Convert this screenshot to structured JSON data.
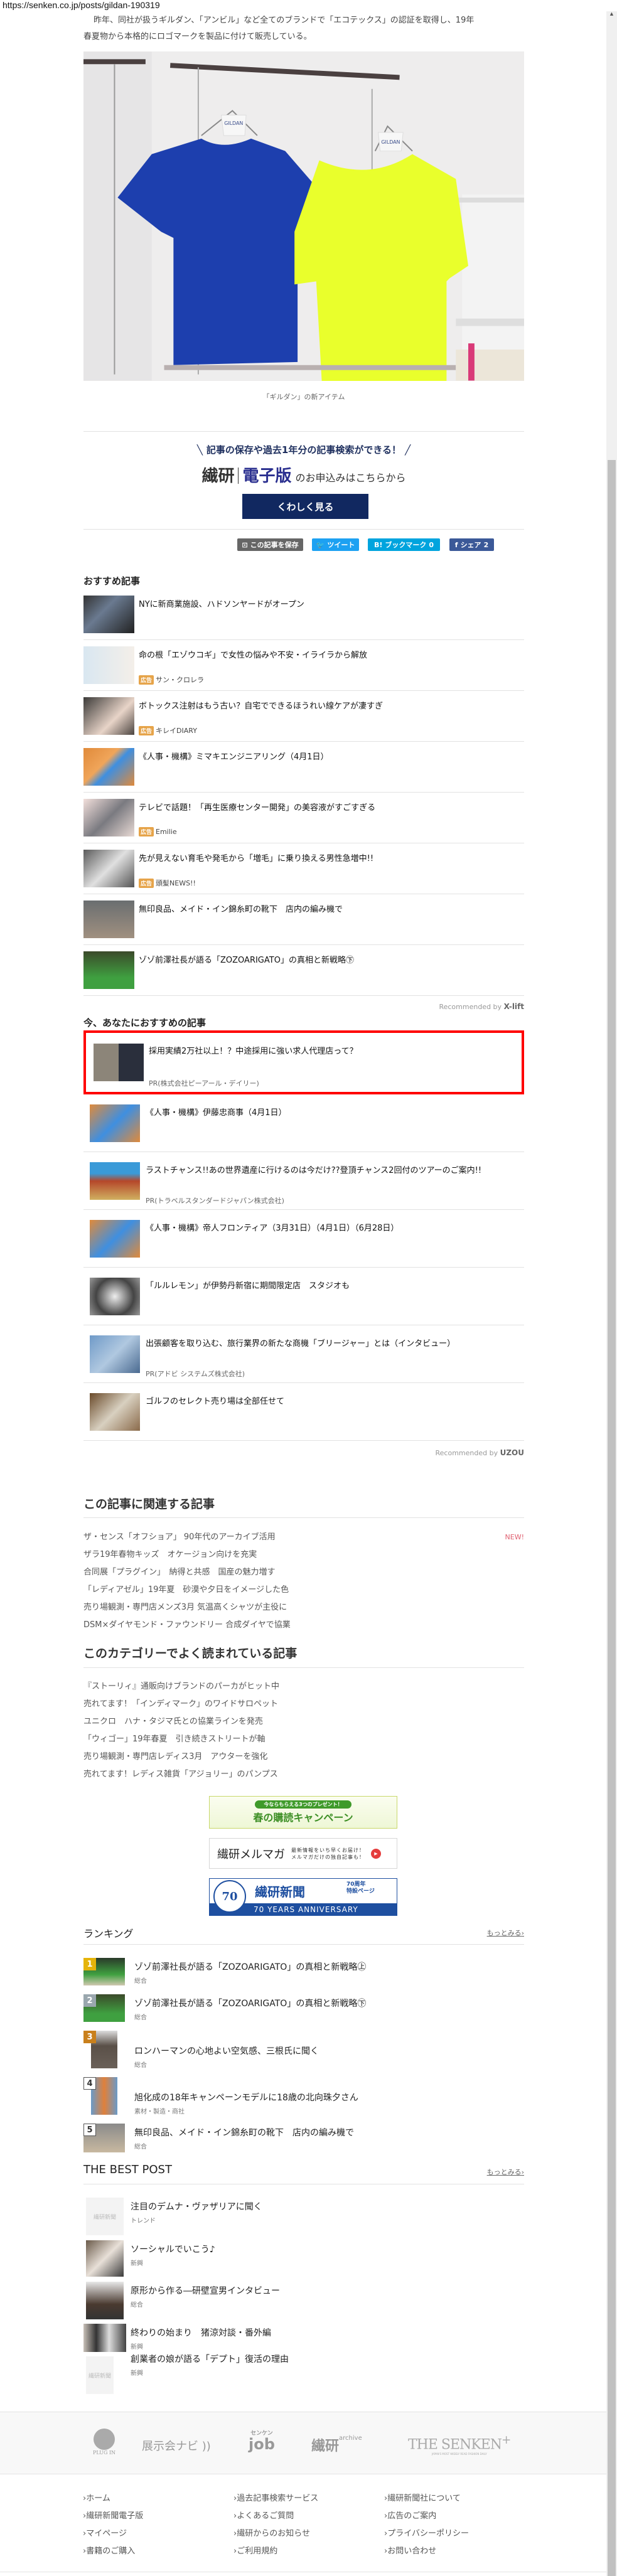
{
  "url": "https://senken.co.jp/posts/gildan-190319",
  "article": {
    "lines": [
      "昨年、同社が扱うギルダン、「アンビル」など全てのブランドで「エコテックス」の認証を取得し、19年",
      "春夏物から本格的にロゴマークを製品に付けて販売している。"
    ],
    "caption": "「ギルダン」の新アイテム",
    "photo_text": "GILDAN"
  },
  "promo": {
    "tagline": "記事の保存や過去1年分の記事検索ができる！",
    "logo_left": "繊研",
    "logo_right": "電子版",
    "suffix": "のお申込みはこちらから",
    "button": "くわしく見る"
  },
  "share": {
    "save": "この記事を保存",
    "tweet": "ツイート",
    "bookmark": "ブックマーク",
    "bookmark_count": "0",
    "facebook": "シェア",
    "facebook_count": "2",
    "colors": {
      "save": "#666666",
      "tweet": "#1da1f2",
      "bookmark": "#00a4de",
      "facebook": "#3b5998"
    }
  },
  "recommended": {
    "title": "おすすめ記事",
    "ad_label": "広告",
    "items": [
      {
        "title": "NYに新商業施設、ハドソンヤードがオープン",
        "source": ""
      },
      {
        "title": "命の根「エゾウコギ」で女性の悩みや不安・イライラから解放",
        "source": "サン・クロレラ"
      },
      {
        "title": "ボトックス注射はもう古い？自宅でできるほうれい線ケアが凄すぎ",
        "source": "キレイDIARY"
      },
      {
        "title": "《人事・機構》ミマキエンジニアリング（4月1日）",
        "source": ""
      },
      {
        "title": "テレビで話題！「再生医療センター開発」の美容液がすごすぎる",
        "source": "Emilie"
      },
      {
        "title": "先が見えない育毛や発毛から「増毛」に乗り換える男性急増中!!",
        "source": "頭髪NEWS!!"
      },
      {
        "title": "無印良品、メイド・イン錦糸町の靴下　店内の編み機で",
        "source": ""
      },
      {
        "title": "ゾゾ前澤社長が語る「ZOZOARIGATO」の真相と新戦略㊦",
        "source": ""
      }
    ],
    "recommended_by": "Recommended by",
    "provider": "X-lift"
  },
  "for_you": {
    "title": "今、あなたにおすすめの記事",
    "highlighted": {
      "title": "採用実績2万社以上！？中途採用に強い求人代理店って？",
      "pr": "PR(株式会社ピーアール・デイリー)"
    },
    "items": [
      {
        "title": "《人事・機構》伊藤忠商事（4月1日）",
        "pr": ""
      },
      {
        "title": "ラストチャンス!!あの世界遺産に行けるのは今だけ??登頂チャンス2回付のツアーのご案内!!",
        "pr": "PR(トラベルスタンダードジャパン株式会社)"
      },
      {
        "title": "《人事・機構》帝人フロンティア（3月31日）（4月1日）（6月28日）",
        "pr": ""
      },
      {
        "title": "「ルルレモン」が伊勢丹新宿に期間限定店　スタジオも",
        "pr": ""
      },
      {
        "title": "出張顧客を取り込む、旅行業界の新たな商機「ブリージャー」とは（インタビュー）",
        "pr": "PR(アドビ システムズ株式会社)"
      },
      {
        "title": "ゴルフのセレクト売り場は全部任せて",
        "pr": ""
      }
    ],
    "recommended_by": "Recommended by",
    "provider": "UZOU"
  },
  "related": {
    "title": "この記事に関連する記事",
    "new_label": "NEW!",
    "items": [
      "ザ・センス「オフショア」 90年代のアーカイブ活用",
      "ザラ19年春物キッズ　オケージョン向けを充実",
      "合同展「プラグイン」　納得と共感　国産の魅力増す",
      "「レディアゼル」19年夏　砂漠や夕日をイメージした色",
      "売り場観測・専門店メンズ3月 気温高くシャツが主役に",
      "DSM×ダイヤモンド・ファウンドリー 合成ダイヤで協業"
    ]
  },
  "category": {
    "title": "このカテゴリーでよく読まれている記事",
    "items": [
      "『ストーリィ』通販向けブランドのパーカがヒット中",
      "売れてます！「インディマーク」のワイドサロペット",
      "ユニクロ　ハナ・タジマ氏との協業ラインを発売",
      "「ウィゴー」19年春夏　引き続きストリートが軸",
      "売り場観測・専門店レディス3月　アウターを強化",
      "売れてます！レディス雑貨「アジョリー」のパンプス"
    ]
  },
  "banners": {
    "campaign_top": "今ならもらえる3つのプレゼント！",
    "campaign_main": "春の購読キャンペーン",
    "mail_title": "繊研メルマガ",
    "mail_line1": "最新情報をいち早くお届け！",
    "mail_line2": "メルマガだけの独自記事も！",
    "anniv_title": "繊研新聞",
    "anniv_years": "70周年",
    "anniv_page": "特設ページ",
    "anniv_badge": "70",
    "anniv_en": "70 YEARS ANNIVERSARY"
  },
  "ranking": {
    "title": "ランキング",
    "more": "もっとみる",
    "items": [
      {
        "rank": "1",
        "title": "ゾゾ前澤社長が語る「ZOZOARIGATO」の真相と新戦略㊤",
        "category": "総合",
        "color": "#e5b40a"
      },
      {
        "rank": "2",
        "title": "ゾゾ前澤社長が語る「ZOZOARIGATO」の真相と新戦略㊦",
        "category": "総合",
        "color": "#9aa7ae"
      },
      {
        "rank": "3",
        "title": "ロンハーマンの心地よい空気感、三根氏に聞く",
        "category": "総合",
        "color": "#c9801c"
      },
      {
        "rank": "4",
        "title": "旭化成の18年キャンペーンモデルに18歳の北向珠夕さん",
        "category": "素材・製造・商社",
        "color": "#ffffff"
      },
      {
        "rank": "5",
        "title": "無印良品、メイド・イン錦糸町の靴下　店内の編み機で",
        "category": "総合",
        "color": "#ffffff"
      }
    ]
  },
  "best_post": {
    "title": "THE BEST POST",
    "more": "もっとみる",
    "placeholder": "繊研新聞",
    "items": [
      {
        "title": "注目のデムナ・ヴァザリアに聞く",
        "category": "トレンド"
      },
      {
        "title": "ソーシャルでいこう♪",
        "category": "新興"
      },
      {
        "title": "原形から作る―研壁宣男インタビュー",
        "category": "総合"
      },
      {
        "title": "終わりの始まり　猪涼対談・番外編",
        "category": "新興"
      },
      {
        "title": "創業者の娘が語る「デプト」復活の理由",
        "category": "新興"
      }
    ]
  },
  "footer": {
    "logos": {
      "plugin": "PLUG IN",
      "navi": "展示会ナビ",
      "job_kana": "センケン",
      "job": "job",
      "archive_main": "繊研",
      "archive_sub": "archive",
      "senken_plus": "THE SENKEN",
      "senken_sub": "JAPAN'S MOST WIDELY READ FASHION DAILY"
    },
    "links": [
      "ホーム",
      "過去記事検索サービス",
      "繊研新聞社について",
      "繊研新聞電子版",
      "よくあるご質問",
      "広告のご案内",
      "マイページ",
      "繊研からのお知らせ",
      "プライバシーポリシー",
      "書籍のご購入",
      "ご利用規約",
      "お問い合わせ"
    ]
  }
}
